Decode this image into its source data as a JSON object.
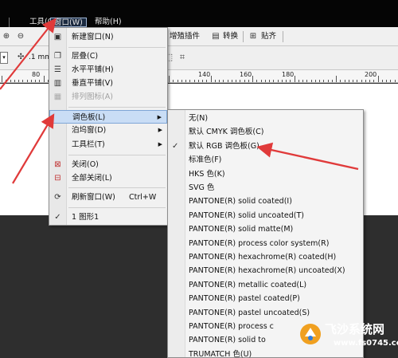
{
  "menubar": {
    "items": [
      "工具(O)",
      "窗口(W)",
      "帮助(H)"
    ]
  },
  "toolbar": {
    "enhance_plugin": "增殖插件",
    "convert": "转换",
    "align": "贴齐"
  },
  "propbar": {
    "nudge_value": ".1 mm"
  },
  "ruler": {
    "labels": [
      "80",
      "140",
      "160",
      "180",
      "200"
    ]
  },
  "window_menu": {
    "items": [
      {
        "label": "新建窗口(N)",
        "icon": "new-window-icon"
      },
      {
        "label": "层叠(C)",
        "icon": "cascade-icon"
      },
      {
        "label": "水平平铺(H)",
        "icon": "tile-horizontal-icon"
      },
      {
        "label": "垂直平铺(V)",
        "icon": "tile-vertical-icon"
      },
      {
        "label": "排列图标(A)",
        "icon": "arrange-icons-icon",
        "disabled": true
      },
      {
        "label": "调色板(L)",
        "highlighted": true
      },
      {
        "label": "泊坞窗(D)"
      },
      {
        "label": "工具栏(T)"
      },
      {
        "label": "关闭(O)",
        "icon": "close-window-icon"
      },
      {
        "label": "全部关闭(L)",
        "icon": "close-all-icon"
      },
      {
        "label": "刷新窗口(W)",
        "shortcut": "Ctrl+W",
        "icon": "refresh-icon"
      },
      {
        "label": "1 图形1",
        "checked": true
      }
    ]
  },
  "palette_menu": {
    "items": [
      "无(N)",
      "默认 CMYK 调色板(C)",
      "默认 RGB 调色板(G)",
      "标准色(F)",
      "HKS 色(K)",
      "SVG 色",
      "PANTONE(R) solid coated(I)",
      "PANTONE(R) solid uncoated(T)",
      "PANTONE(R) solid matte(M)",
      "PANTONE(R) process color system(R)",
      "PANTONE(R) hexachrome(R) coated(H)",
      "PANTONE(R) hexachrome(R) uncoated(X)",
      "PANTONE(R) metallic coated(L)",
      "PANTONE(R) pastel coated(P)",
      "PANTONE(R) pastel uncoated(S)",
      "PANTONE(R) process c",
      "PANTONE(R) solid to",
      "TRUMATCH 色(U)"
    ],
    "checked": "默认 RGB 调色板(G)"
  },
  "watermark": {
    "title": "飞沙系统网",
    "url": "www.fs0745.com"
  },
  "colors": {
    "menubar_bg": "#050505",
    "highlight": "#c9ddf5",
    "arrow": "#e03a3a"
  }
}
